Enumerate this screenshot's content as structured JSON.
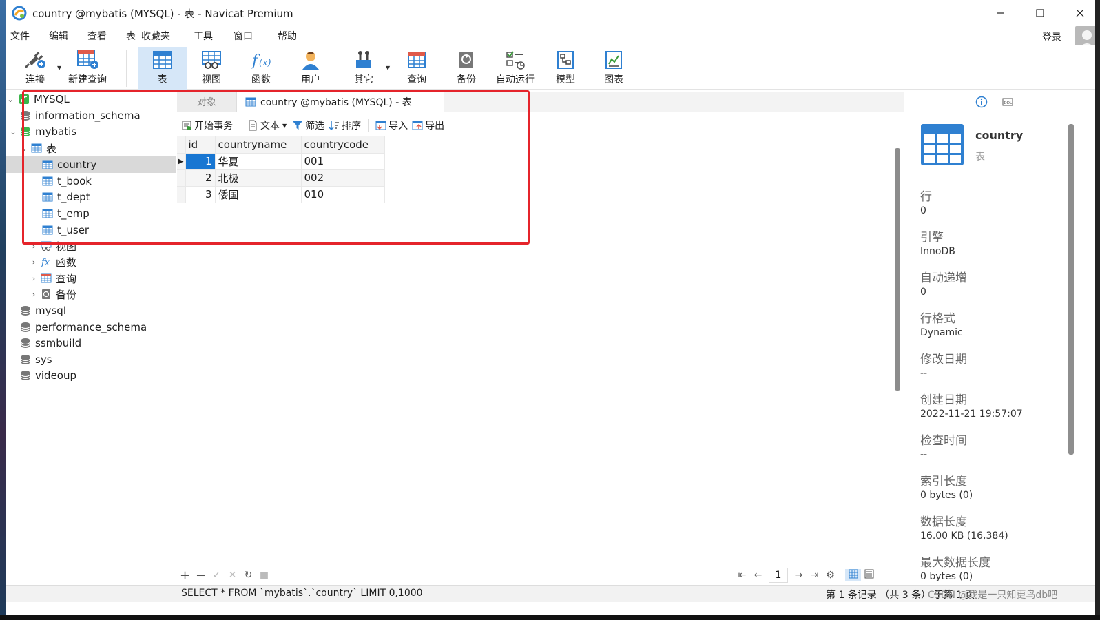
{
  "window": {
    "title": "country @mybatis (MYSQL) - 表 - Navicat Premium"
  },
  "menu": [
    "文件",
    "编辑",
    "查看",
    "表",
    "收藏夹",
    "工具",
    "窗口",
    "帮助"
  ],
  "account": {
    "login_label": "登录"
  },
  "toolbar": {
    "connect": "连接",
    "new_query": "新建查询",
    "table": "表",
    "view": "视图",
    "function": "函数",
    "user": "用户",
    "other": "其它",
    "query": "查询",
    "backup": "备份",
    "auto_run": "自动运行",
    "model": "模型",
    "chart": "图表"
  },
  "tree": {
    "connection": "MYSQL",
    "databases_top": [
      "information_schema"
    ],
    "open_db": "mybatis",
    "tables_group": "表",
    "tables": [
      "country",
      "t_book",
      "t_dept",
      "t_emp",
      "t_user"
    ],
    "selected_table": "country",
    "groups": [
      "视图",
      "函数",
      "查询",
      "备份"
    ],
    "databases_bottom": [
      "mysql",
      "performance_schema",
      "ssmbuild",
      "sys",
      "videoup"
    ]
  },
  "tabs": {
    "objects": "对象",
    "current": "country @mybatis (MYSQL) - 表"
  },
  "subtoolbar": {
    "begin_transaction": "开始事务",
    "text": "文本",
    "filter": "筛选",
    "sort": "排序",
    "import": "导入",
    "export": "导出"
  },
  "grid": {
    "columns": [
      "id",
      "countryname",
      "countrycode"
    ],
    "rows": [
      [
        "1",
        "华夏",
        "001"
      ],
      [
        "2",
        "北极",
        "002"
      ],
      [
        "3",
        "倭国",
        "010"
      ]
    ]
  },
  "pager": {
    "page": "1"
  },
  "status": {
    "sql": "SELECT * FROM `mybatis`.`country` LIMIT 0,1000",
    "records": "第 1 条记录 （共 3 条） 于第 1 页",
    "watermark": "CSDN @我是一只知更鸟db吧"
  },
  "info": {
    "name": "country",
    "type": "表",
    "props": [
      {
        "label": "行",
        "value": "0"
      },
      {
        "label": "引擎",
        "value": "InnoDB"
      },
      {
        "label": "自动递增",
        "value": "0"
      },
      {
        "label": "行格式",
        "value": "Dynamic"
      },
      {
        "label": "修改日期",
        "value": "--"
      },
      {
        "label": "创建日期",
        "value": "2022-11-21 19:57:07"
      },
      {
        "label": "检查时间",
        "value": "--"
      },
      {
        "label": "索引长度",
        "value": "0 bytes (0)"
      },
      {
        "label": "数据长度",
        "value": "16.00 KB (16,384)"
      },
      {
        "label": "最大数据长度",
        "value": "0 bytes (0)"
      }
    ]
  },
  "colors": {
    "accent": "#1876d2",
    "highlight_box": "#e5242b",
    "active_tool": "#d6e7f8"
  }
}
